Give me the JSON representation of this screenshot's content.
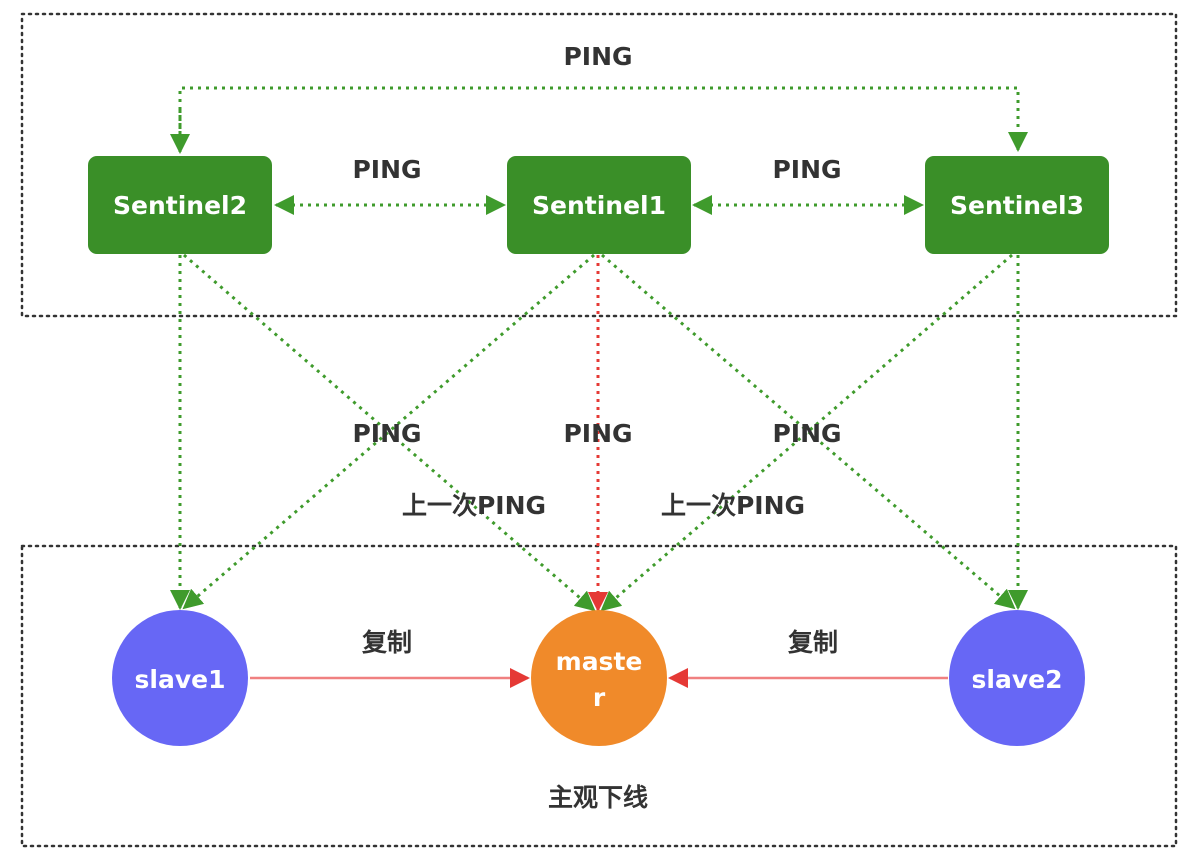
{
  "nodes": {
    "sentinel1": "Sentinel1",
    "sentinel2": "Sentinel2",
    "sentinel3": "Sentinel3",
    "slave1": "slave1",
    "slave2": "slave2",
    "master_line1": "maste",
    "master_line2": "r"
  },
  "labels": {
    "ping_top": "PING",
    "ping_s2_s1": "PING",
    "ping_s1_s3": "PING",
    "ping_left": "PING",
    "ping_center": "PING",
    "ping_right": "PING",
    "last_ping_left": "上一次PING",
    "last_ping_right": "上一次PING",
    "replicate_left": "复制",
    "replicate_right": "复制",
    "subjective_down": "主观下线"
  },
  "colors": {
    "sentinel_fill": "#3a8f28",
    "slave_fill": "#6767f5",
    "master_fill": "#f08a2a",
    "ping_line": "#3f9b2c",
    "failed_ping_line": "#e53935",
    "replication_line": "#f08080",
    "group_border": "#333333"
  }
}
